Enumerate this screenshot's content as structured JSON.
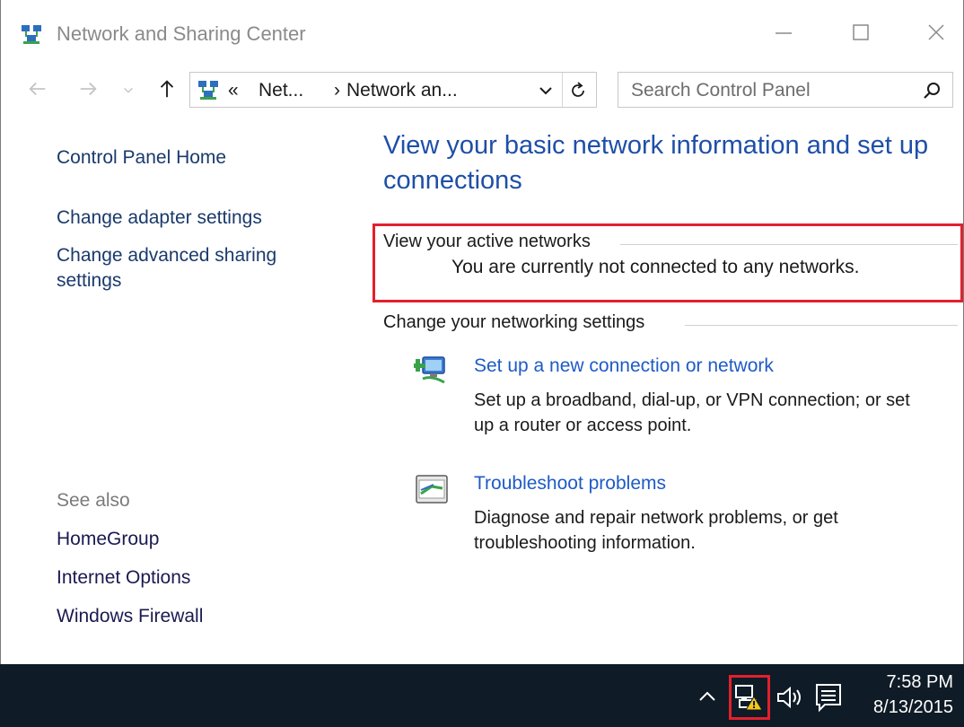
{
  "window": {
    "title": "Network and Sharing Center"
  },
  "navbar": {
    "breadcrumb_overflow": "«",
    "crumb1": "Net...",
    "crumb_sep": "›",
    "crumb2": "Network an...",
    "search_placeholder": "Search Control Panel"
  },
  "sidebar": {
    "home": "Control Panel Home",
    "links": [
      "Change adapter settings",
      "Change advanced sharing",
      "settings"
    ],
    "see_also_label": "See also",
    "see_also": [
      "HomeGroup",
      "Internet Options",
      "Windows Firewall"
    ]
  },
  "main": {
    "heading_line1": "View your basic network information and set up",
    "heading_line2": "connections",
    "active_networks_label": "View your active networks",
    "active_networks_status": "You are currently not connected to any networks.",
    "change_settings_label": "Change your networking settings",
    "tasks": [
      {
        "icon": "new-connection-icon",
        "link": "Set up a new connection or network",
        "desc_line1": "Set up a broadband, dial-up, or VPN connection; or set",
        "desc_line2": "up a router or access point."
      },
      {
        "icon": "troubleshoot-icon",
        "link": "Troubleshoot problems",
        "desc_line1": "Diagnose and repair network problems, or get",
        "desc_line2": "troubleshooting information."
      }
    ]
  },
  "taskbar": {
    "time": "7:58 PM",
    "date": "8/13/2015",
    "tray_icons": [
      "chevron-up-icon",
      "network-warning-icon",
      "volume-icon",
      "action-center-icon"
    ]
  },
  "colors": {
    "link_blue": "#1e5bc6",
    "heading_blue": "#1e4fa8",
    "highlight_red": "#e3202d",
    "taskbar_bg": "#0f1b26"
  }
}
